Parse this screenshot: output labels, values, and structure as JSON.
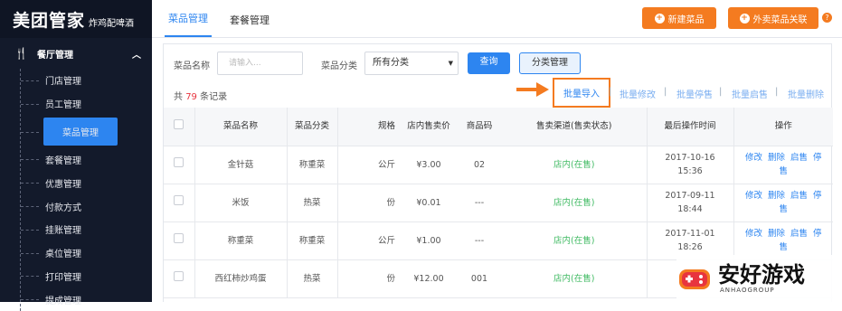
{
  "sidebar": {
    "logo_main": "美团管家",
    "logo_sub": "炸鸡配啤酒",
    "group_label": "餐厅管理",
    "items": [
      {
        "label": "门店管理"
      },
      {
        "label": "员工管理"
      },
      {
        "label": "菜品管理"
      },
      {
        "label": "套餐管理"
      },
      {
        "label": "优惠管理"
      },
      {
        "label": "付款方式"
      },
      {
        "label": "挂账管理"
      },
      {
        "label": "桌位管理"
      },
      {
        "label": "打印管理"
      },
      {
        "label": "提成管理"
      }
    ]
  },
  "header": {
    "tabs": [
      {
        "label": "菜品管理"
      },
      {
        "label": "套餐管理"
      }
    ],
    "new_dish": "新建菜品",
    "takeout_link": "外卖菜品关联",
    "help": "?"
  },
  "filters": {
    "name_label": "菜品名称",
    "name_placeholder": "请输入...",
    "category_label": "菜品分类",
    "category_value": "所有分类",
    "query": "查询",
    "category_manage": "分类管理"
  },
  "summary": {
    "prefix": "共",
    "count": "79",
    "suffix": "条记录"
  },
  "bulk": {
    "import": "批量导入",
    "edit": "批量修改",
    "stop": "批量停售",
    "enable": "批量启售",
    "delete": "批量删除"
  },
  "table": {
    "headers": {
      "name": "菜品名称",
      "category": "菜品分类",
      "unit": "规格",
      "price": "店内售卖价",
      "code": "商品码",
      "channel": "售卖渠道(售卖状态)",
      "time": "最后操作时间",
      "actions": "操作"
    },
    "rows": [
      {
        "name": "金针菇",
        "category": "称重菜",
        "unit": "公斤",
        "price": "¥3.00",
        "code": "02",
        "channel": "店内(在售)",
        "date": "2017-10-16",
        "time": "15:36"
      },
      {
        "name": "米饭",
        "category": "热菜",
        "unit": "份",
        "price": "¥0.01",
        "code": "---",
        "channel": "店内(在售)",
        "date": "2017-09-11",
        "time": "18:44"
      },
      {
        "name": "称重菜",
        "category": "称重菜",
        "unit": "公斤",
        "price": "¥1.00",
        "code": "---",
        "channel": "店内(在售)",
        "date": "2017-11-01",
        "time": "18:26"
      },
      {
        "name": "西红柿炒鸡蛋",
        "category": "热菜",
        "unit": "份",
        "price": "¥12.00",
        "code": "001",
        "channel": "店内(在售)",
        "date": "",
        "time": ""
      }
    ],
    "actions": {
      "edit": "修改",
      "delete": "删除",
      "enable": "启售",
      "stop": "停",
      "stop2": "售"
    }
  },
  "watermark": {
    "title": "安好游戏",
    "sub": "ANHAOGROUP"
  },
  "colors": {
    "accent": "#2d85f0",
    "orange": "#f47b20",
    "sidebar": "#131a2b",
    "green": "#3fba62",
    "red": "#e8343e"
  }
}
